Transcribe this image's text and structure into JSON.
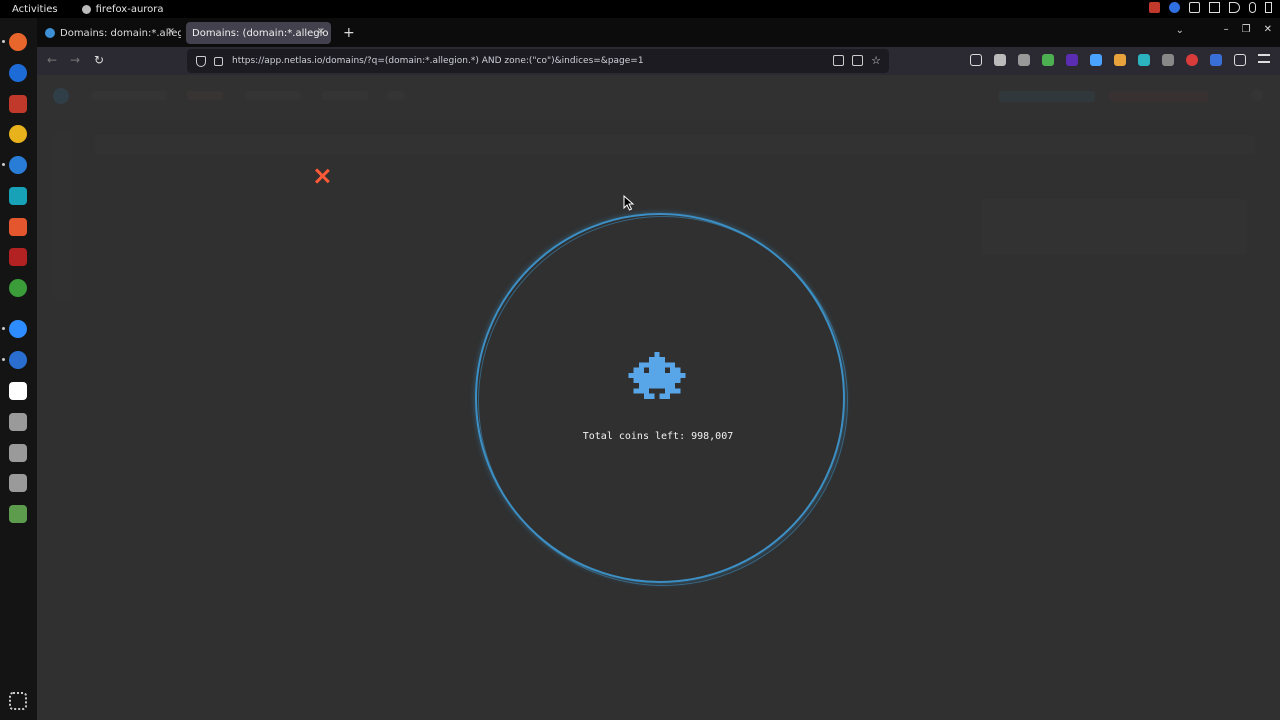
{
  "topbar": {
    "activities": "Activities",
    "app_name": "firefox-aurora"
  },
  "browser": {
    "tabs": [
      {
        "title": "Domains: domain:*.allegi",
        "close": "×"
      },
      {
        "title": "Domains: (domain:*.allegio",
        "close": "×"
      }
    ],
    "new_tab": "+",
    "url": "https://app.netlas.io/domains/?q=(domain:*.allegion.*) AND zone:(\"co\")&indices=&page=1"
  },
  "loader": {
    "total_coins_text": "Total coins left: 998,007",
    "ring_color": "#3c8fc4",
    "icon": "space-invader-icon",
    "icon_color": "#58a6e8"
  },
  "colors": {
    "close_accent": "#ff5a36",
    "overlay": "#373737"
  }
}
